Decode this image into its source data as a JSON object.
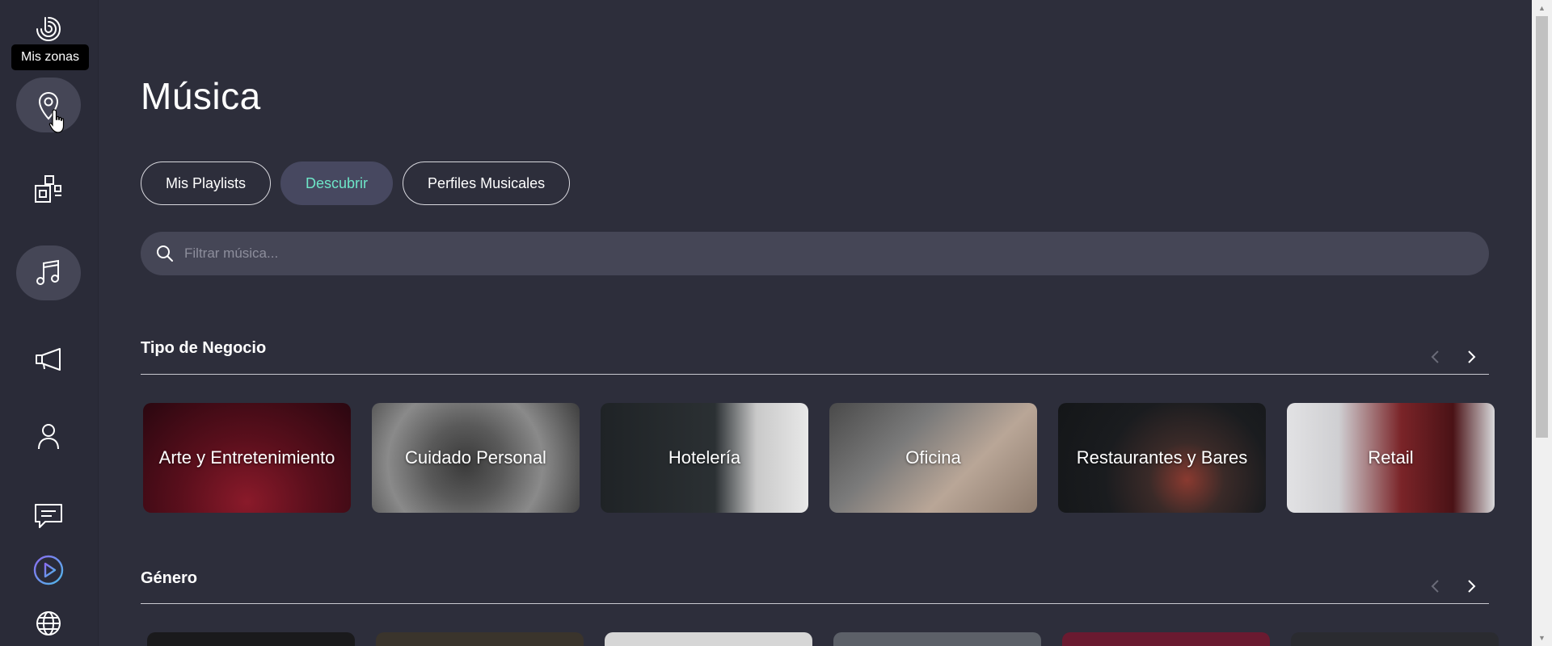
{
  "sidebar": {
    "tooltip": "Mis zonas",
    "items": [
      {
        "name": "zonas",
        "icon": "map-pin-icon"
      },
      {
        "name": "dispositivos",
        "icon": "devices-icon"
      },
      {
        "name": "musica",
        "icon": "music-note-icon"
      },
      {
        "name": "anuncios",
        "icon": "megaphone-icon"
      },
      {
        "name": "usuario",
        "icon": "user-icon"
      },
      {
        "name": "mensajes",
        "icon": "chat-icon"
      },
      {
        "name": "reproductor",
        "icon": "play-circle-icon"
      },
      {
        "name": "idioma",
        "icon": "globe-icon"
      }
    ]
  },
  "page": {
    "title": "Música"
  },
  "tabs": [
    {
      "label": "Mis Playlists",
      "active": false
    },
    {
      "label": "Descubrir",
      "active": true
    },
    {
      "label": "Perfiles Musicales",
      "active": false
    }
  ],
  "search": {
    "placeholder": "Filtrar música..."
  },
  "sections": {
    "business": {
      "title": "Tipo de Negocio",
      "cards": [
        {
          "label": "Arte y Entretenimiento"
        },
        {
          "label": "Cuidado Personal"
        },
        {
          "label": "Hotelería"
        },
        {
          "label": "Oficina"
        },
        {
          "label": "Restaurantes y Bares"
        },
        {
          "label": "Retail"
        }
      ]
    },
    "genre": {
      "title": "Género"
    }
  },
  "colors": {
    "background": "#2d2e3b",
    "active_tab_text": "#6ee6c8",
    "accent_purple": "#8a6cf0"
  }
}
